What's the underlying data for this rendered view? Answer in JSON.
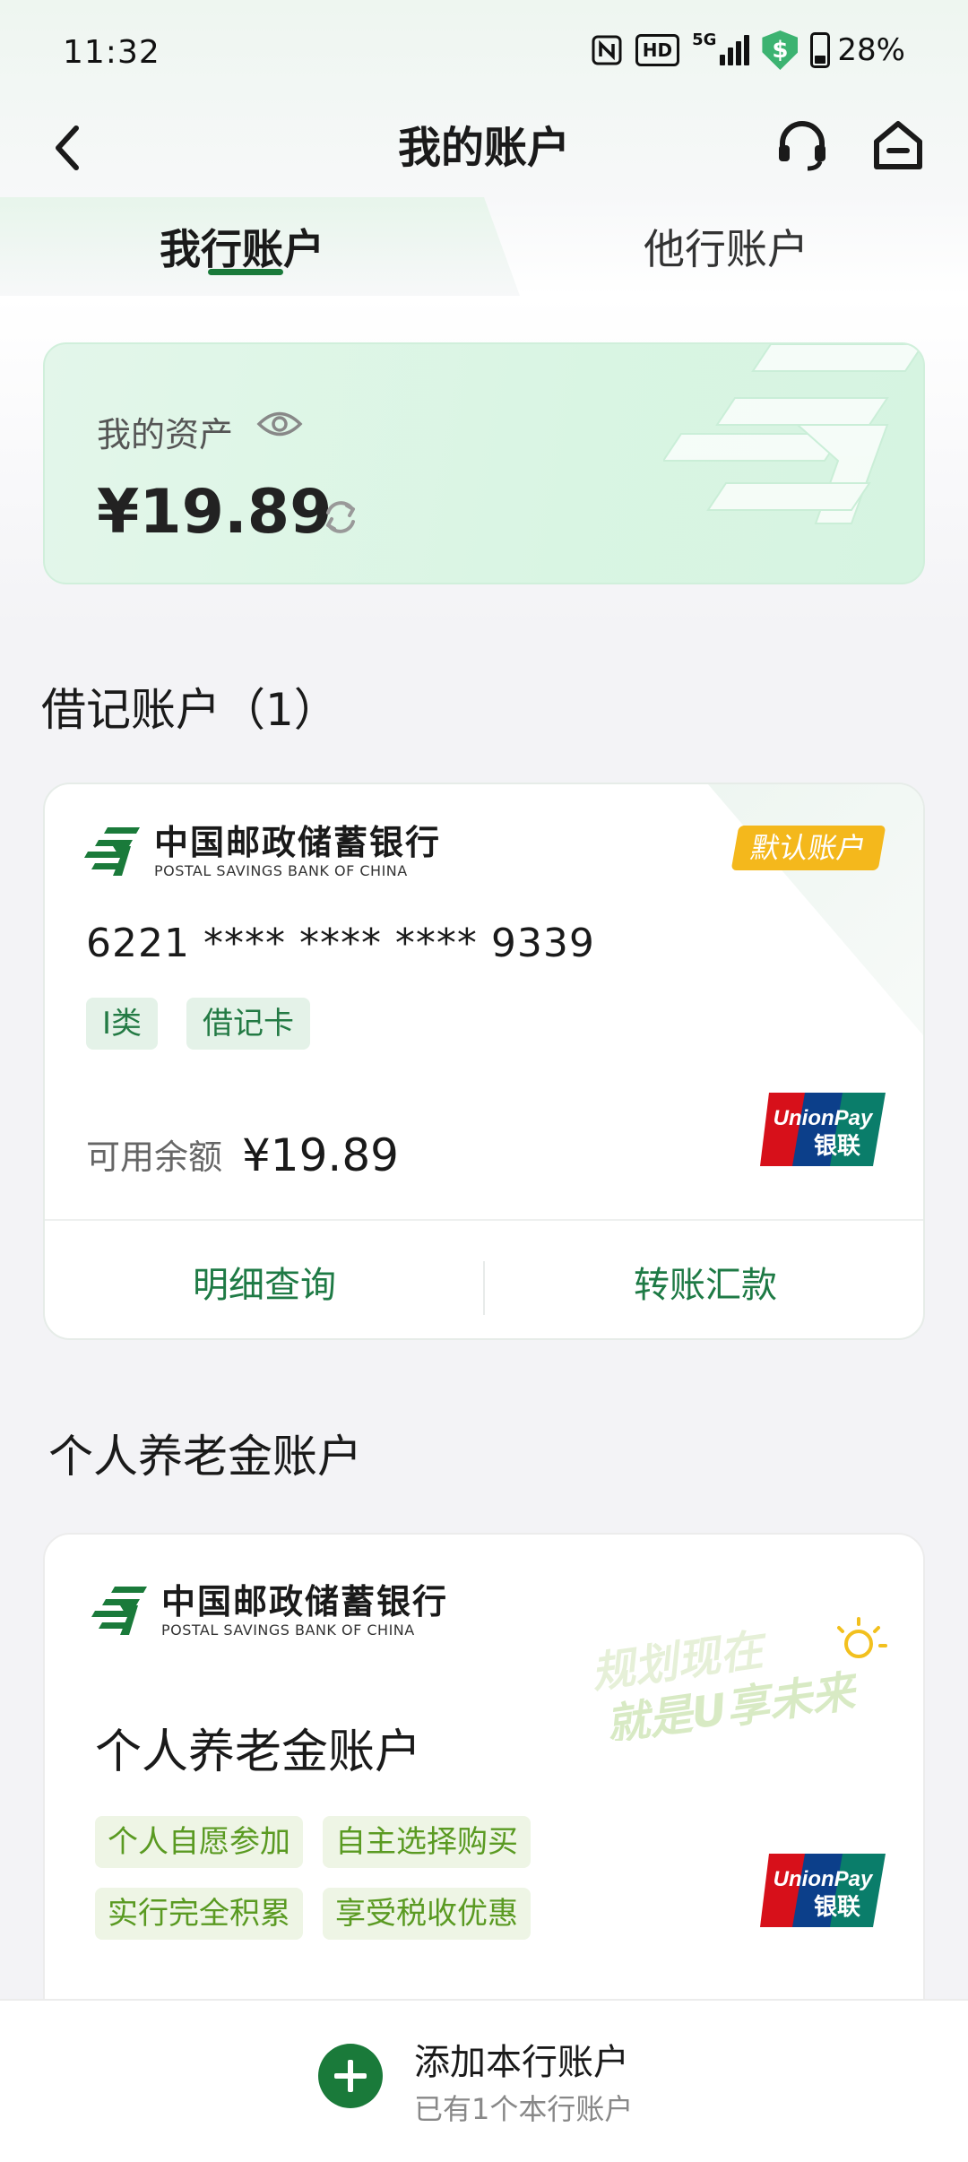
{
  "status_bar": {
    "time": "11:32",
    "network": "5G",
    "hd_label": "HD",
    "battery": "28%"
  },
  "header": {
    "title": "我的账户"
  },
  "tabs": [
    {
      "label": "我行账户",
      "active": true
    },
    {
      "label": "他行账户",
      "active": false
    }
  ],
  "assets": {
    "label": "我的资产",
    "amount": "¥19.89"
  },
  "debit_section": {
    "title": "借记账户（1）"
  },
  "debit_card": {
    "bank_name_cn": "中国邮政储蓄银行",
    "bank_name_en": "POSTAL SAVINGS BANK OF CHINA",
    "default_badge": "默认账户",
    "card_number": "6221 **** **** **** 9339",
    "tags": [
      "I类",
      "借记卡"
    ],
    "balance_label": "可用余额",
    "balance": "¥19.89",
    "actions": [
      "明细查询",
      "转账汇款"
    ]
  },
  "pension_section": {
    "title": "个人养老金账户"
  },
  "pension_card": {
    "bank_name_cn": "中国邮政储蓄银行",
    "bank_name_en": "POSTAL SAVINGS BANK OF CHINA",
    "slogan_line1": "规划现在",
    "slogan_line2": "就是U享未来",
    "title": "个人养老金账户",
    "tags": [
      "个人自愿参加",
      "自主选择购买",
      "实行完全积累",
      "享受税收优惠"
    ]
  },
  "bottom_bar": {
    "title": "添加本行账户",
    "subtitle": "已有1个本行账户"
  },
  "colors": {
    "brand_green": "#1a7a3a",
    "badge_yellow": "#f4b81c",
    "pension_tag_green": "#5a9a22"
  }
}
